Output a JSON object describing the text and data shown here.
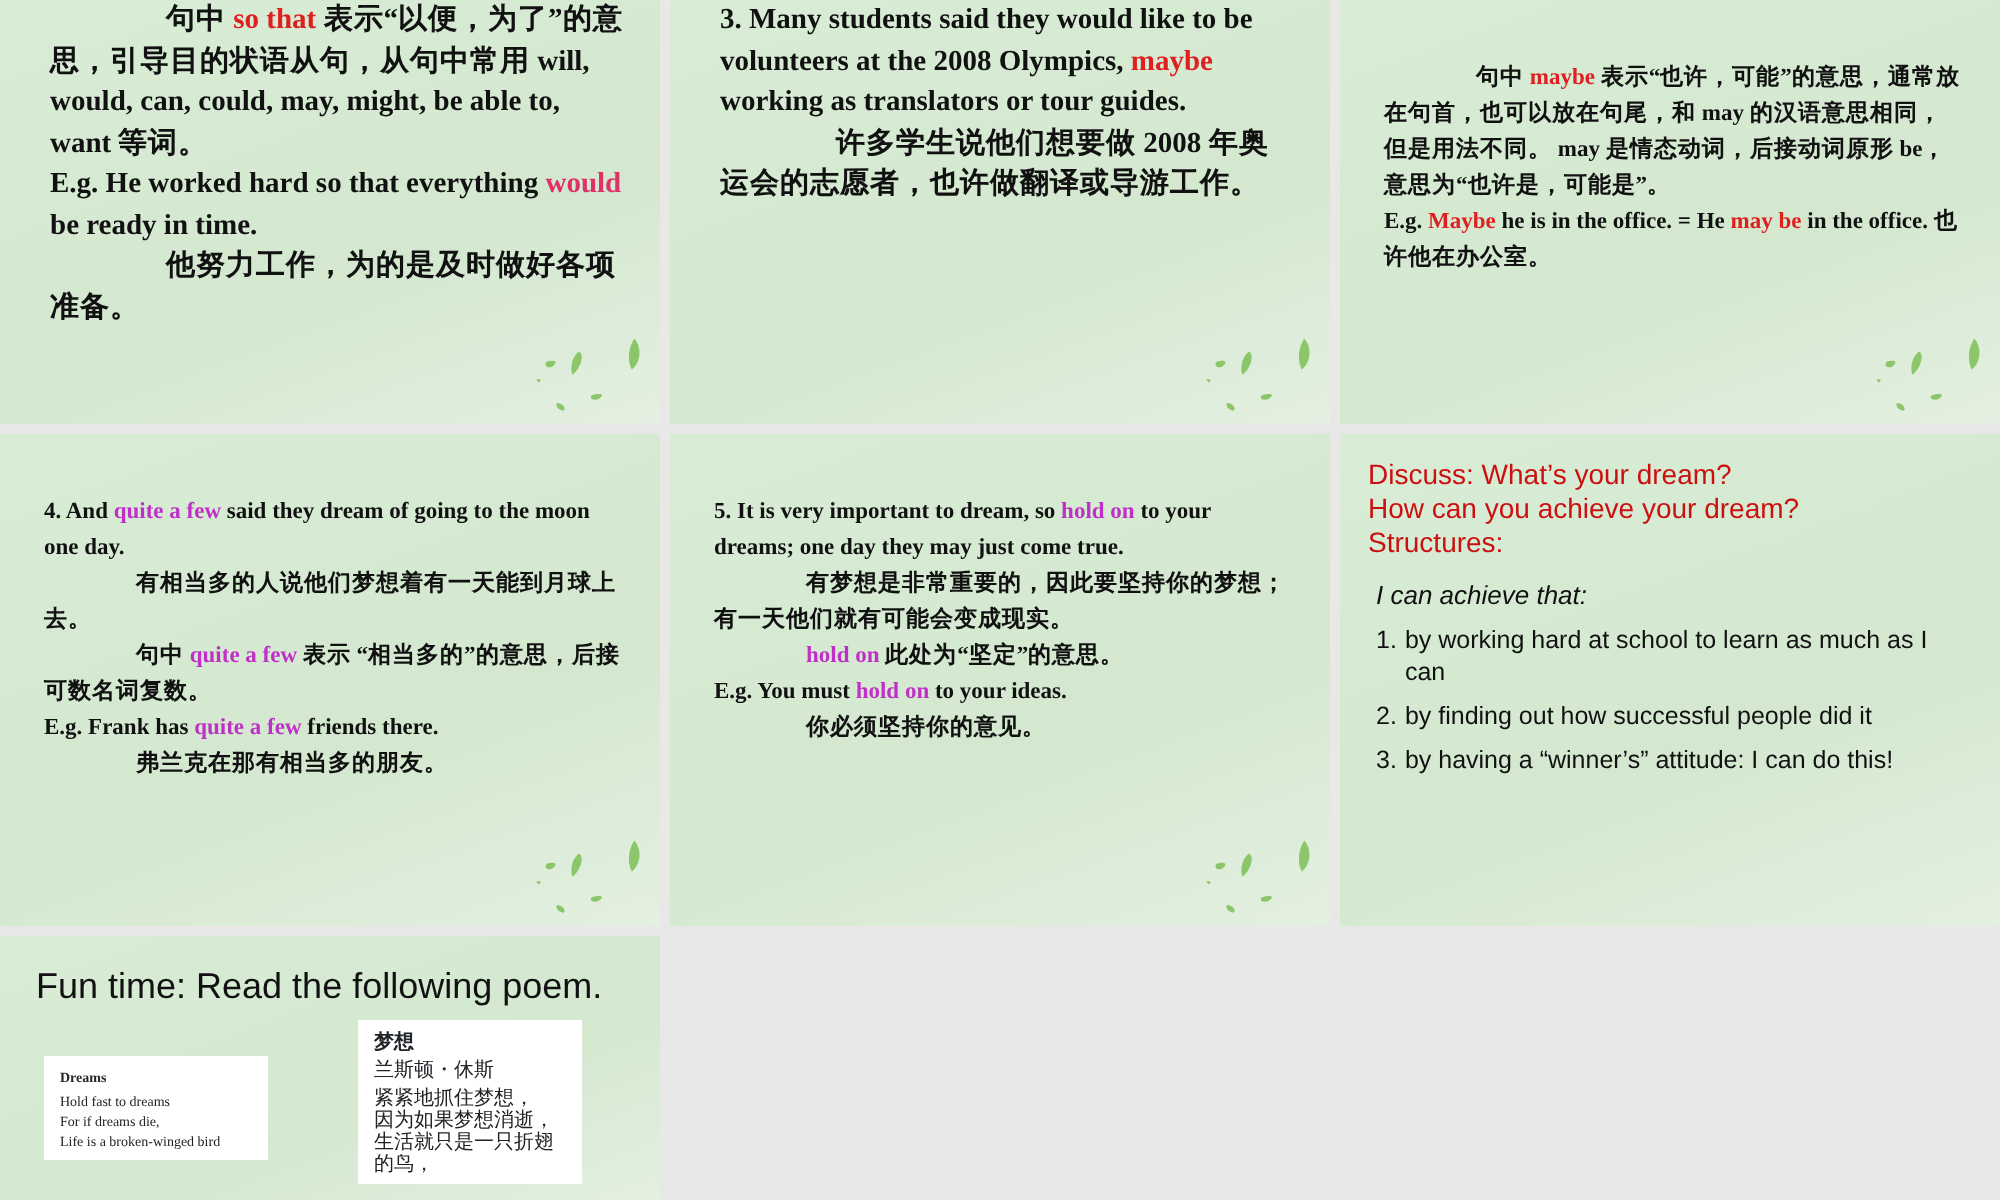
{
  "slides": [
    {
      "kind": "large_text",
      "paragraphs": [
        {
          "indented": true,
          "segments": [
            {
              "text": "句中 "
            },
            {
              "text": "so that",
              "color": "#e02020"
            },
            {
              "text": " 表示“以便，为了”的意思，引导目的状语从句，从句中常用 will, would, can, could, may, might, be able to, want 等词。"
            }
          ]
        },
        {
          "indented": false,
          "segments": [
            {
              "text": "E.g. He worked hard so that everything "
            },
            {
              "text": "would",
              "color": "#e0306a"
            },
            {
              "text": " be ready in time."
            }
          ]
        },
        {
          "indented": true,
          "segments": [
            {
              "text": "他努力工作，为的是及时做好各项准备。"
            }
          ]
        }
      ]
    },
    {
      "kind": "large_text",
      "paragraphs": [
        {
          "indented": false,
          "segments": [
            {
              "text": "3. Many students said they would like to be volunteers at the 2008 Olympics, "
            },
            {
              "text": "maybe",
              "color": "#e02020"
            },
            {
              "text": " working as translators or tour guides."
            }
          ]
        },
        {
          "indented": true,
          "segments": [
            {
              "text": "许多学生说他们想要做 2008 年奥运会的志愿者，也许做翻译或导游工作。"
            }
          ]
        }
      ]
    },
    {
      "kind": "small_text",
      "paragraphs": [
        {
          "indented": true,
          "segments": [
            {
              "text": "句中 "
            },
            {
              "text": "maybe",
              "color": "#e02020"
            },
            {
              "text": " 表示“也许，可能”的意思，通常放在句首，也可以放在句尾，和 may 的汉语意思相同，但是用法不同。 may 是情态动词，后接动词原形 be，意思为“也许是，可能是”。"
            }
          ]
        },
        {
          "indented": false,
          "segments": [
            {
              "text": "E.g. "
            },
            {
              "text": "Maybe",
              "color": "#e02020"
            },
            {
              "text": " he is in the office. = He "
            },
            {
              "text": "may be",
              "color": "#e02020"
            },
            {
              "text": " in the office.  也许他在办公室。"
            }
          ]
        }
      ]
    },
    {
      "kind": "small_text",
      "paragraphs": [
        {
          "indented": false,
          "segments": [
            {
              "text": "4. And "
            },
            {
              "text": "quite a few",
              "color": "#c030c8"
            },
            {
              "text": " said they dream of going to the moon one day."
            }
          ]
        },
        {
          "indented": true,
          "segments": [
            {
              "text": "有相当多的人说他们梦想着有一天能到月球上去。"
            }
          ]
        },
        {
          "indented": true,
          "segments": [
            {
              "text": "句中 "
            },
            {
              "text": "quite a few",
              "color": "#c030c8"
            },
            {
              "text": " 表示 “相当多的”的意思，后接可数名词复数。"
            }
          ]
        },
        {
          "indented": false,
          "segments": [
            {
              "text": "E.g. Frank has "
            },
            {
              "text": "quite a few",
              "color": "#c030c8"
            },
            {
              "text": " friends there."
            }
          ]
        },
        {
          "indented": true,
          "segments": [
            {
              "text": "弗兰克在那有相当多的朋友。"
            }
          ]
        }
      ]
    },
    {
      "kind": "small_text",
      "paragraphs": [
        {
          "indented": false,
          "segments": [
            {
              "text": "5. It is very important to dream, so "
            },
            {
              "text": "hold on",
              "color": "#c030c8"
            },
            {
              "text": " to your dreams; one day they may just come true."
            }
          ]
        },
        {
          "indented": true,
          "segments": [
            {
              "text": "有梦想是非常重要的，因此要坚持你的梦想；有一天他们就有可能会变成现实。"
            }
          ]
        },
        {
          "indented": true,
          "segments": [
            {
              "text": "hold on",
              "color": "#c030c8"
            },
            {
              "text": " 此处为“坚定”的意思。"
            }
          ]
        },
        {
          "indented": false,
          "segments": [
            {
              "text": "E.g. You must "
            },
            {
              "text": "hold on",
              "color": "#c030c8"
            },
            {
              "text": " to your ideas."
            }
          ]
        },
        {
          "indented": true,
          "segments": [
            {
              "text": "你必须坚持你的意见。"
            }
          ]
        }
      ]
    },
    {
      "kind": "discussion",
      "headings": [
        "Discuss: What’s your dream?",
        "How can you achieve your dream?",
        "Structures:"
      ],
      "subheading": "I can achieve that:",
      "items": [
        {
          "number": "1.",
          "text": "by working hard at school to learn as much as I can"
        },
        {
          "number": "2.",
          "text": "by finding out how successful people did it"
        },
        {
          "number": "3.",
          "text": "by having a “winner’s” attitude: I can do this!"
        }
      ]
    },
    {
      "kind": "poem",
      "title": "Fun time: Read the following poem.",
      "cards": [
        {
          "title": "Dreams",
          "lines": [
            "Hold fast to dreams",
            "For if dreams die,",
            "Life is a broken-winged bird"
          ]
        },
        {
          "title": "梦想",
          "author": "兰斯顿・休斯",
          "lines": [
            "紧紧地抓住梦想，",
            "因为如果梦想消逝，",
            "生活就只是一只折翅的鸟，"
          ]
        }
      ]
    }
  ]
}
